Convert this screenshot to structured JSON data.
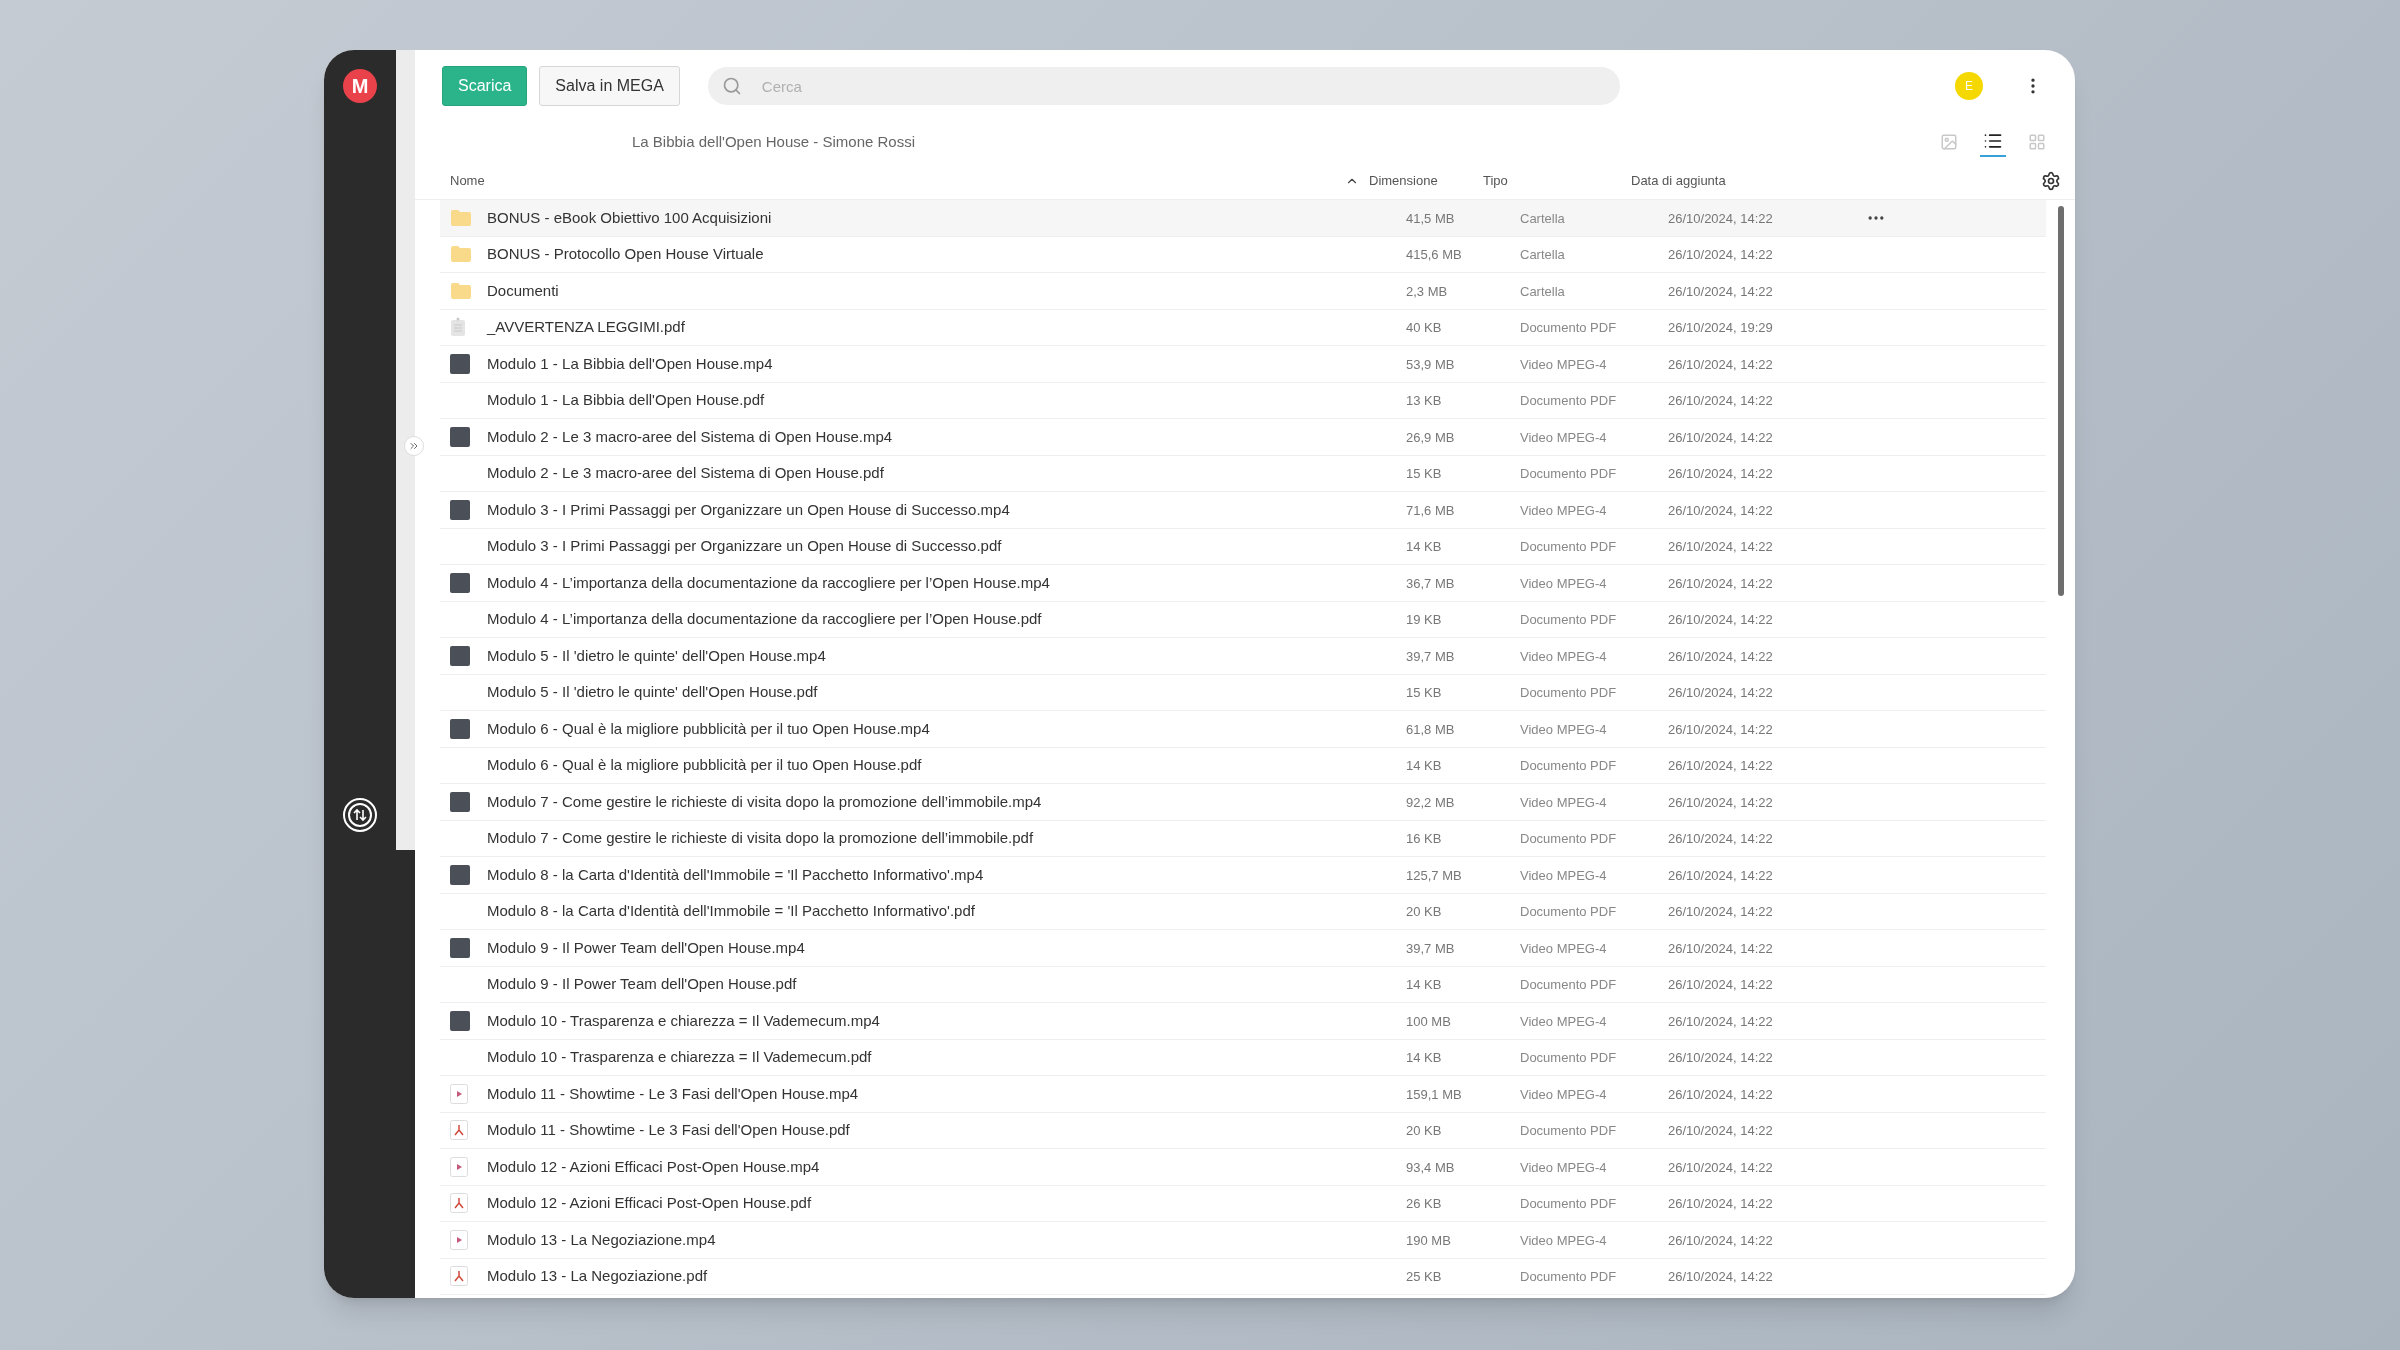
{
  "sidebar": {
    "logo_text": "M"
  },
  "toolbar": {
    "buttons": [
      {
        "label": "Scarica",
        "kind": "primary"
      },
      {
        "label": "Salva in MEGA",
        "kind": "secondary"
      }
    ],
    "search": {
      "placeholder": "Cerca"
    },
    "avatar": {
      "initial": "E",
      "color": "#f5d800"
    }
  },
  "breadcrumb": "La Bibbia dell'Open House - Simone Rossi",
  "view_modes": [
    {
      "kind": "image",
      "selected": false
    },
    {
      "kind": "list",
      "selected": true
    },
    {
      "kind": "grid",
      "selected": false
    }
  ],
  "table": {
    "columns": [
      {
        "label": "Nome",
        "sorted": true
      },
      {
        "label": "Dimensione",
        "sorted": false
      },
      {
        "label": "Tipo",
        "sorted": false
      },
      {
        "label": "Data di aggiunta",
        "sorted": false
      }
    ],
    "rows": [
      {
        "kind": "folder",
        "name": "BONUS - eBook Obiettivo 100 Acquisizioni",
        "size": "41,5 MB",
        "type": "Cartella",
        "date": "26/10/2024, 14:22",
        "highlighted": true
      },
      {
        "kind": "folder",
        "name": "BONUS - Protocollo Open House Virtuale",
        "size": "415,6 MB",
        "type": "Cartella",
        "date": "26/10/2024, 14:22",
        "highlighted": false
      },
      {
        "kind": "folder",
        "name": "Documenti",
        "size": "2,3 MB",
        "type": "Cartella",
        "date": "26/10/2024, 14:22",
        "highlighted": false
      },
      {
        "kind": "page",
        "name": "_AVVERTENZA LEGGIMI.pdf",
        "size": "40 KB",
        "type": "Documento PDF",
        "date": "26/10/2024, 19:29",
        "highlighted": false
      },
      {
        "kind": "photo",
        "name": "Modulo 1 - La Bibbia dell'Open House.mp4",
        "size": "53,9 MB",
        "type": "Video MPEG-4",
        "date": "26/10/2024, 14:22",
        "highlighted": false
      },
      {
        "kind": "none",
        "name": "Modulo 1 - La Bibbia dell'Open House.pdf",
        "size": "13 KB",
        "type": "Documento PDF",
        "date": "26/10/2024, 14:22",
        "highlighted": false
      },
      {
        "kind": "photo",
        "name": "Modulo 2 - Le 3 macro-aree del Sistema di Open House.mp4",
        "size": "26,9 MB",
        "type": "Video MPEG-4",
        "date": "26/10/2024, 14:22",
        "highlighted": false
      },
      {
        "kind": "none",
        "name": "Modulo 2 - Le 3 macro-aree del Sistema di Open House.pdf",
        "size": "15 KB",
        "type": "Documento PDF",
        "date": "26/10/2024, 14:22",
        "highlighted": false
      },
      {
        "kind": "photo",
        "name": "Modulo 3 - I Primi Passaggi per Organizzare un Open House di Successo.mp4",
        "size": "71,6 MB",
        "type": "Video MPEG-4",
        "date": "26/10/2024, 14:22",
        "highlighted": false
      },
      {
        "kind": "none",
        "name": "Modulo 3 - I Primi Passaggi per Organizzare un Open House di Successo.pdf",
        "size": "14 KB",
        "type": "Documento PDF",
        "date": "26/10/2024, 14:22",
        "highlighted": false
      },
      {
        "kind": "photo",
        "name": "Modulo 4 - L’importanza della documentazione da raccogliere per l’Open House.mp4",
        "size": "36,7 MB",
        "type": "Video MPEG-4",
        "date": "26/10/2024, 14:22",
        "highlighted": false
      },
      {
        "kind": "none",
        "name": "Modulo 4 - L’importanza della documentazione da raccogliere per l’Open House.pdf",
        "size": "19 KB",
        "type": "Documento PDF",
        "date": "26/10/2024, 14:22",
        "highlighted": false
      },
      {
        "kind": "photo",
        "name": "Modulo 5 - Il 'dietro le quinte' dell'Open House.mp4",
        "size": "39,7 MB",
        "type": "Video MPEG-4",
        "date": "26/10/2024, 14:22",
        "highlighted": false
      },
      {
        "kind": "none",
        "name": "Modulo 5 - Il 'dietro le quinte' dell'Open House.pdf",
        "size": "15 KB",
        "type": "Documento PDF",
        "date": "26/10/2024, 14:22",
        "highlighted": false
      },
      {
        "kind": "photo",
        "name": "Modulo 6 - Qual è la migliore pubblicità per il tuo Open House.mp4",
        "size": "61,8 MB",
        "type": "Video MPEG-4",
        "date": "26/10/2024, 14:22",
        "highlighted": false
      },
      {
        "kind": "none",
        "name": "Modulo 6 - Qual è la migliore pubblicità per il tuo Open House.pdf",
        "size": "14 KB",
        "type": "Documento PDF",
        "date": "26/10/2024, 14:22",
        "highlighted": false
      },
      {
        "kind": "photo",
        "name": "Modulo 7 - Come gestire le richieste di visita dopo la promozione dell’immobile.mp4",
        "size": "92,2 MB",
        "type": "Video MPEG-4",
        "date": "26/10/2024, 14:22",
        "highlighted": false
      },
      {
        "kind": "none",
        "name": "Modulo 7 - Come gestire le richieste di visita dopo la promozione dell’immobile.pdf",
        "size": "16 KB",
        "type": "Documento PDF",
        "date": "26/10/2024, 14:22",
        "highlighted": false
      },
      {
        "kind": "photo",
        "name": "Modulo 8 - la Carta d'Identità dell'Immobile = 'Il Pacchetto Informativo'.mp4",
        "size": "125,7 MB",
        "type": "Video MPEG-4",
        "date": "26/10/2024, 14:22",
        "highlighted": false
      },
      {
        "kind": "none",
        "name": "Modulo 8 - la Carta d'Identità dell'Immobile = 'Il Pacchetto Informativo'.pdf",
        "size": "20 KB",
        "type": "Documento PDF",
        "date": "26/10/2024, 14:22",
        "highlighted": false
      },
      {
        "kind": "photo",
        "name": "Modulo 9 - Il Power Team dell'Open House.mp4",
        "size": "39,7 MB",
        "type": "Video MPEG-4",
        "date": "26/10/2024, 14:22",
        "highlighted": false
      },
      {
        "kind": "none",
        "name": "Modulo 9 - Il Power Team dell'Open House.pdf",
        "size": "14 KB",
        "type": "Documento PDF",
        "date": "26/10/2024, 14:22",
        "highlighted": false
      },
      {
        "kind": "photo",
        "name": "Modulo 10 - Trasparenza e chiarezza = Il Vademecum.mp4",
        "size": "100 MB",
        "type": "Video MPEG-4",
        "date": "26/10/2024, 14:22",
        "highlighted": false
      },
      {
        "kind": "none",
        "name": "Modulo 10 - Trasparenza e chiarezza = Il Vademecum.pdf",
        "size": "14 KB",
        "type": "Documento PDF",
        "date": "26/10/2024, 14:22",
        "highlighted": false
      },
      {
        "kind": "video",
        "name": "Modulo 11 - Showtime - Le 3 Fasi dell'Open House.mp4",
        "size": "159,1 MB",
        "type": "Video MPEG-4",
        "date": "26/10/2024, 14:22",
        "highlighted": false
      },
      {
        "kind": "pdf",
        "name": "Modulo 11 - Showtime - Le 3 Fasi dell'Open House.pdf",
        "size": "20 KB",
        "type": "Documento PDF",
        "date": "26/10/2024, 14:22",
        "highlighted": false
      },
      {
        "kind": "video",
        "name": "Modulo 12 - Azioni Efficaci Post-Open House.mp4",
        "size": "93,4 MB",
        "type": "Video MPEG-4",
        "date": "26/10/2024, 14:22",
        "highlighted": false
      },
      {
        "kind": "pdf",
        "name": "Modulo 12 - Azioni Efficaci Post-Open House.pdf",
        "size": "26 KB",
        "type": "Documento PDF",
        "date": "26/10/2024, 14:22",
        "highlighted": false
      },
      {
        "kind": "video",
        "name": "Modulo 13 - La Negoziazione.mp4",
        "size": "190 MB",
        "type": "Video MPEG-4",
        "date": "26/10/2024, 14:22",
        "highlighted": false
      },
      {
        "kind": "pdf",
        "name": "Modulo 13 - La Negoziazione.pdf",
        "size": "25 KB",
        "type": "Documento PDF",
        "date": "26/10/2024, 14:22",
        "highlighted": false
      }
    ]
  }
}
